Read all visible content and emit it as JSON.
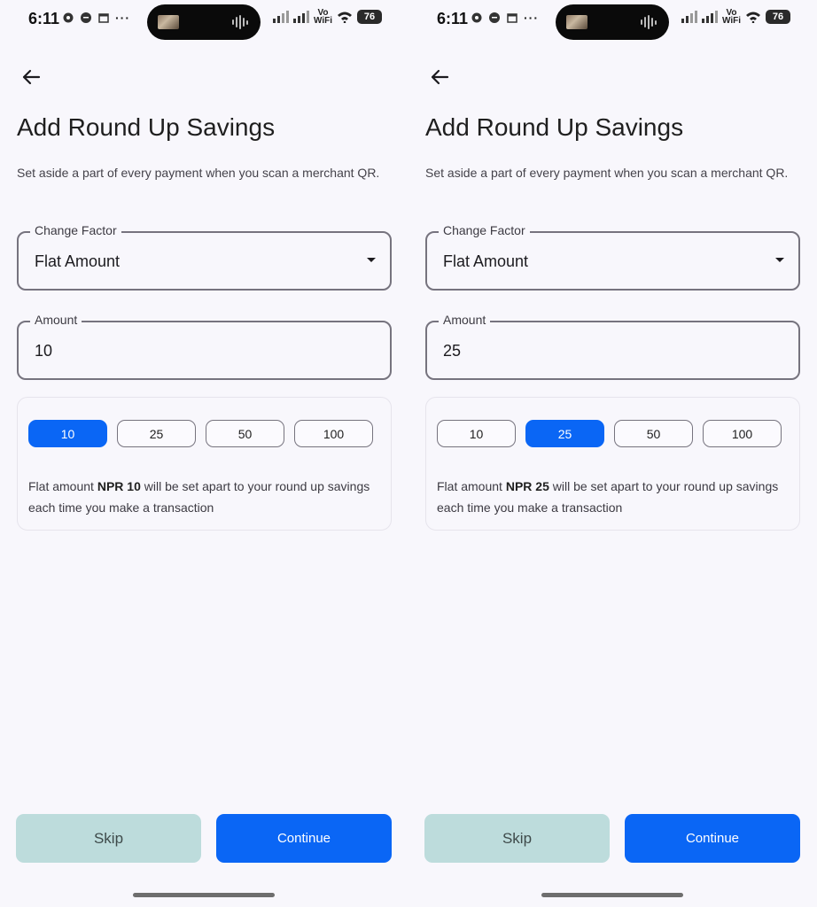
{
  "status_bar": {
    "time": "6:11",
    "vo_wifi_top": "Vo",
    "vo_wifi_bottom": "WiFi",
    "battery": "76"
  },
  "screens": [
    {
      "title": "Add Round Up Savings",
      "subtitle": "Set aside a part of every payment when you scan a merchant QR.",
      "change_factor": {
        "label": "Change Factor",
        "value": "Flat Amount"
      },
      "amount": {
        "label": "Amount",
        "value": "10"
      },
      "presets": [
        "10",
        "25",
        "50",
        "100"
      ],
      "selected_preset": "10",
      "description": {
        "prefix": "Flat amount ",
        "highlight": "NPR 10",
        "suffix": " will be set apart to your round up savings each time you make a transaction"
      },
      "skip_label": "Skip",
      "continue_label": "Continue"
    },
    {
      "title": "Add Round Up Savings",
      "subtitle": "Set aside a part of every payment when you scan a merchant QR.",
      "change_factor": {
        "label": "Change Factor",
        "value": "Flat Amount"
      },
      "amount": {
        "label": "Amount",
        "value": "25"
      },
      "presets": [
        "10",
        "25",
        "50",
        "100"
      ],
      "selected_preset": "25",
      "description": {
        "prefix": "Flat amount ",
        "highlight": "NPR 25",
        "suffix": " will be set apart to your round up savings each time you make a transaction"
      },
      "skip_label": "Skip",
      "continue_label": "Continue"
    }
  ],
  "colors": {
    "primary": "#0a66f5",
    "skip_bg": "#bddcdc",
    "background": "#f8f7fc",
    "outline": "#76737e"
  },
  "icons": [
    "gear-icon",
    "chat-bubble-icon",
    "calendar-icon",
    "more-dots-icon",
    "back-arrow-icon",
    "dropdown-caret-icon",
    "signal-icon",
    "wifi-icon",
    "battery-icon"
  ]
}
